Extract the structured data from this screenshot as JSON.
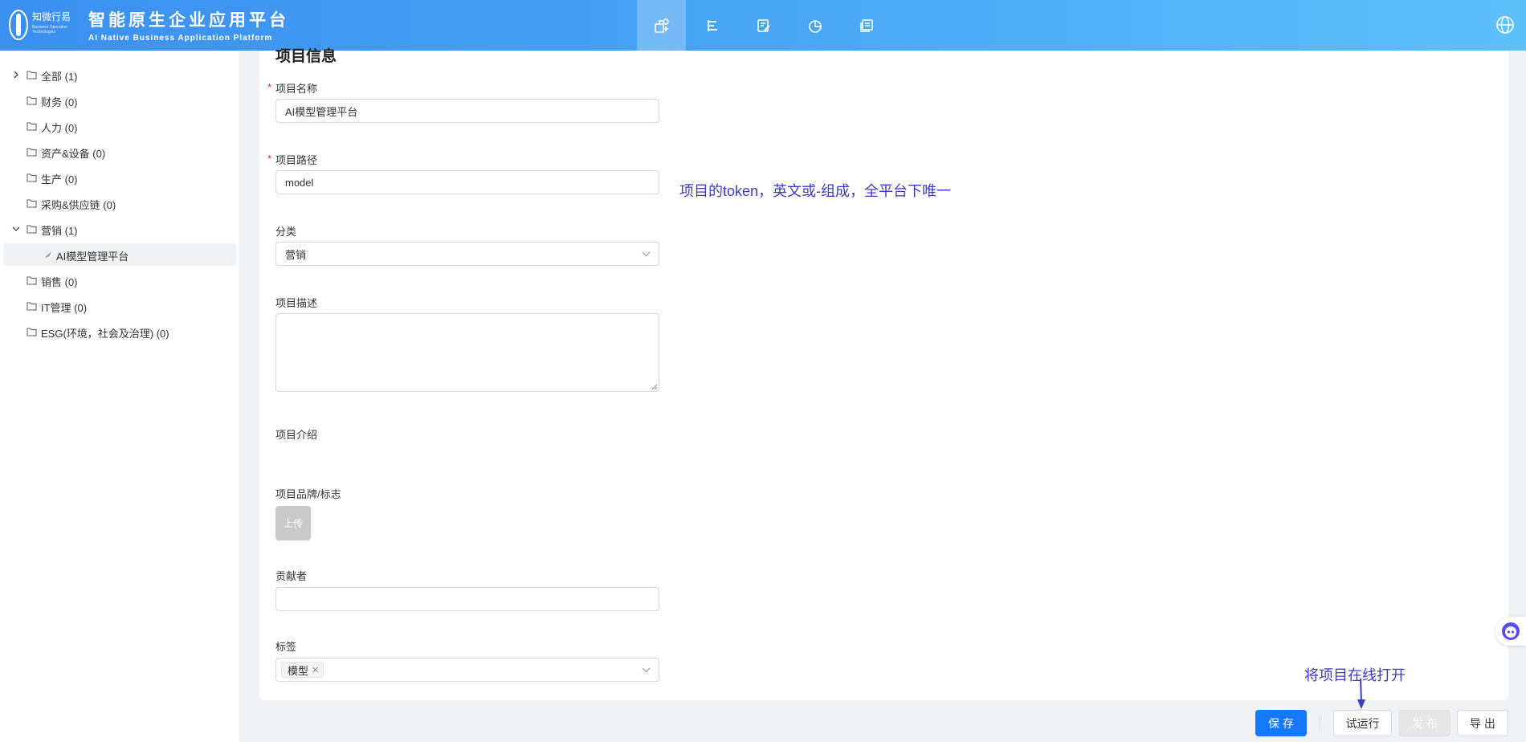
{
  "header": {
    "logo_zh": "知微行易",
    "logo_en": "Business Operation Technologies",
    "title": "智能原生企业应用平台",
    "subtitle": "AI Native Business Application Platform",
    "nav_icons": [
      "app-design-icon",
      "tree-structure-icon",
      "edit-doc-icon",
      "pie-chart-icon",
      "gallery-icon"
    ],
    "active_nav": 0
  },
  "sidebar": {
    "items": [
      {
        "label": "全部 (1)"
      },
      {
        "label": "财务 (0)"
      },
      {
        "label": "人力 (0)"
      },
      {
        "label": "资产&设备 (0)"
      },
      {
        "label": "生产 (0)"
      },
      {
        "label": "采购&供应链 (0)"
      },
      {
        "label": "营销 (1)"
      },
      {
        "label": "AI模型管理平台"
      },
      {
        "label": "销售 (0)"
      },
      {
        "label": "IT管理 (0)"
      },
      {
        "label": "ESG(环境，社会及治理) (0)"
      }
    ]
  },
  "form": {
    "section_title": "项目信息",
    "name_label": "项目名称",
    "name_value": "AI模型管理平台",
    "path_label": "项目路径",
    "path_value": "model",
    "category_label": "分类",
    "category_value": "营销",
    "desc_label": "项目描述",
    "intro_label": "项目介绍",
    "brand_label": "项目品牌/标志",
    "upload_label": "上传",
    "contributors_label": "贡献者",
    "tags_label": "标签",
    "tag_value": "模型",
    "required_mark": "*"
  },
  "annotations": {
    "path_hint": "项目的token，英文或-组成，全平台下唯一",
    "run_hint": "将项目在线打开"
  },
  "actions": {
    "save": "保 存",
    "trial_run": "试运行",
    "publish": "发 布",
    "export": "导 出"
  },
  "colors": {
    "primary": "#1677ff",
    "annotation": "#3a3cc8",
    "required": "#f5222d"
  }
}
